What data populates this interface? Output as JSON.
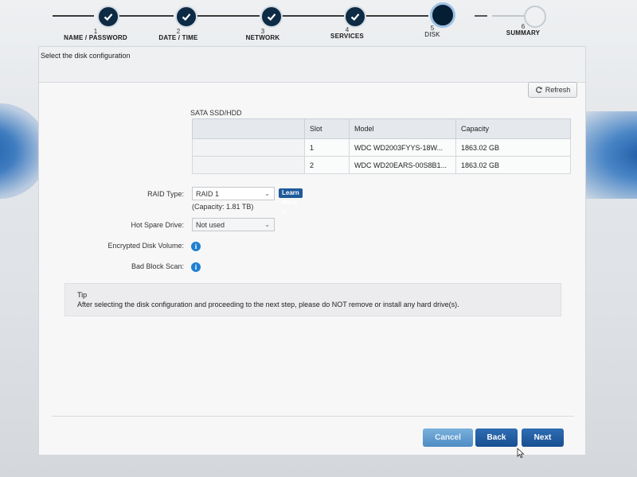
{
  "wizard": {
    "steps": [
      {
        "num": "1",
        "label": "NAME / PASSWORD",
        "state": "done"
      },
      {
        "num": "2",
        "label": "DATE / TIME",
        "state": "done"
      },
      {
        "num": "3",
        "label": "NETWORK",
        "state": "done"
      },
      {
        "num": "4",
        "label": "SERVICES",
        "state": "done"
      },
      {
        "num": "5",
        "label": "DISK",
        "state": "current"
      },
      {
        "num": "6",
        "label": "SUMMARY",
        "state": "future"
      }
    ]
  },
  "panel": {
    "title": "Select the disk configuration",
    "refresh_label": "Refresh",
    "section_title": "SATA SSD/HDD",
    "table": {
      "headers": [
        "",
        "Slot",
        "Model",
        "Capacity"
      ],
      "rows": [
        {
          "slot": "1",
          "model": "WDC WD2003FYYS-18W...",
          "capacity": "1863.02 GB"
        },
        {
          "slot": "2",
          "model": "WDC WD20EARS-00S8B1...",
          "capacity": "1863.02 GB"
        }
      ]
    },
    "raid": {
      "label": "RAID Type:",
      "value": "RAID 1",
      "learn_more": "Learn More »",
      "capacity_note": "(Capacity: 1.81 TB)"
    },
    "hot_spare": {
      "label": "Hot Spare Drive:",
      "value": "Not used"
    },
    "encrypted": {
      "label": "Encrypted Disk Volume:"
    },
    "bad_block": {
      "label": "Bad Block Scan:"
    },
    "tip": {
      "title": "Tip",
      "text": "After selecting the disk configuration and proceeding to the next step, please do NOT remove or install any hard drive(s)."
    },
    "buttons": {
      "cancel": "Cancel",
      "back": "Back",
      "next": "Next"
    }
  },
  "colors": {
    "accent": "#1e5a9c",
    "step_done": "#0d2b45",
    "info": "#1f7fd0"
  }
}
